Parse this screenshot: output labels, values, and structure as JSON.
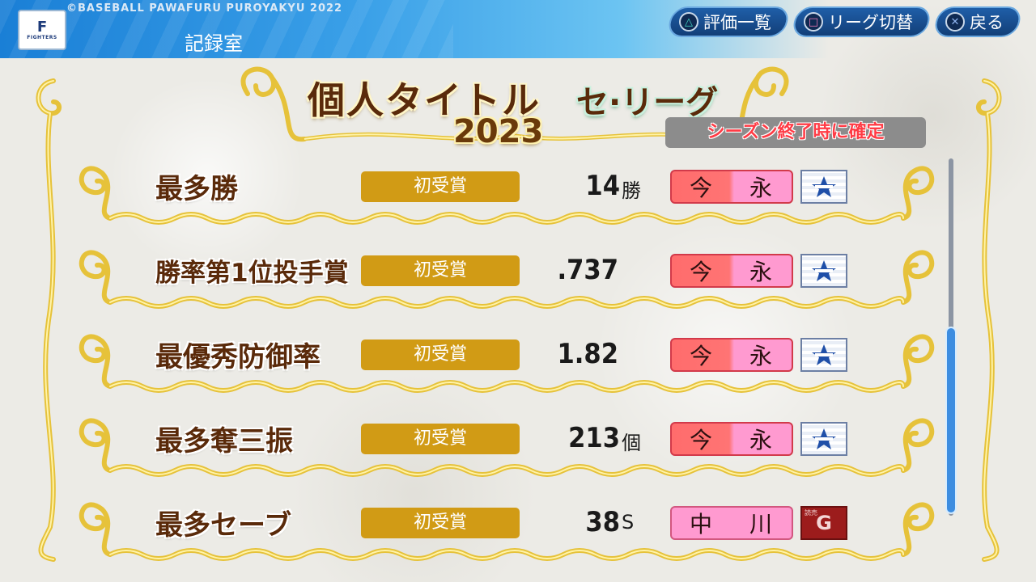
{
  "header": {
    "copyright": "©BASEBALL PAWAFURU PUROYAKYU 2022",
    "screen_title": "記録室",
    "logo_letter": "F",
    "logo_text": "FIGHTERS",
    "buttons": [
      {
        "icon": "triangle-button-icon",
        "label": "評価一覧"
      },
      {
        "icon": "square-button-icon",
        "label": "リーグ切替"
      },
      {
        "icon": "cross-button-icon",
        "label": "戻る"
      }
    ]
  },
  "banner": {
    "title": "個人タイトル",
    "league": "セ·リーグ",
    "year": "2023",
    "status": "シーズン終了時に確定"
  },
  "titles": [
    {
      "name": "最多勝",
      "award": "初受賞",
      "value": "14",
      "unit": "勝",
      "player": [
        "今",
        "永"
      ],
      "team": "baystars"
    },
    {
      "name": "勝率第1位投手賞",
      "award": "初受賞",
      "value": ".737",
      "unit": "",
      "player": [
        "今",
        "永"
      ],
      "team": "baystars"
    },
    {
      "name": "最優秀防御率",
      "award": "初受賞",
      "value": "1.82",
      "unit": "",
      "player": [
        "今",
        "永"
      ],
      "team": "baystars"
    },
    {
      "name": "最多奪三振",
      "award": "初受賞",
      "value": "213",
      "unit": "個",
      "player": [
        "今",
        "永"
      ],
      "team": "baystars"
    },
    {
      "name": "最多セーブ",
      "award": "初受賞",
      "value": "38",
      "unit": "S",
      "player": [
        "中",
        "川"
      ],
      "team": "giants"
    }
  ],
  "team_colors": {
    "baystars": "#1f4fa8",
    "giants": "#9c1c1c"
  },
  "accent": {
    "gold": "#d19b15",
    "header_blue": "#1a7fd6",
    "scroll_blue": "#3d8de0"
  },
  "giants_mark": "G",
  "giants_sub": "読売"
}
